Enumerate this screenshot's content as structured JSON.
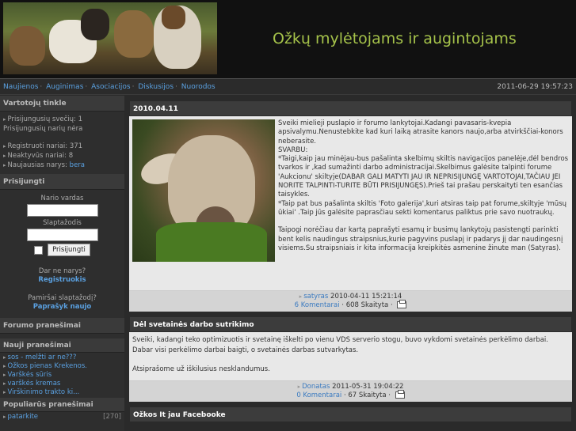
{
  "header": {
    "title": "Ožkų mylėtojams ir augintojams"
  },
  "nav": {
    "links": [
      "Naujienos",
      "Auginimas",
      "Asociacijos",
      "Diskusijos",
      "Nuorodos"
    ],
    "datetime": "2011-06-29 19:57:23"
  },
  "sidebar": {
    "users_panel": {
      "title": "Vartotojų tinkle",
      "online_guests": "Prisijungusių svečių: 1",
      "online_members": "Prisijungusių narių nėra",
      "registered": "Registruoti nariai: 371",
      "inactive": "Neaktyvūs nariai: 8",
      "newest_label": "Naujausias narys: ",
      "newest_name": "bera"
    },
    "login_panel": {
      "title": "Prisijungti",
      "username_label": "Nario vardas",
      "password_label": "Slaptažodis",
      "login_button": "Prisijungti",
      "not_member": "Dar ne narys?",
      "register_link": "Registruokis",
      "forgot": "Pamiršai slaptažodį?",
      "forgot_link": "Paprašyk naujo"
    },
    "forum_panel": {
      "title": "Forumo pranešimai"
    },
    "new_posts": {
      "title": "Nauji pranešimai",
      "items": [
        "sos - melžti ar ne???",
        "Ožkos pienas Krekenos.",
        "Varškės sūris",
        "varškės kremas",
        "Virškinimo trakto ki..."
      ]
    },
    "popular_posts": {
      "title": "Populiarūs pranešimai",
      "items": [
        {
          "label": "patarkite",
          "count": "[270]"
        }
      ]
    }
  },
  "posts": [
    {
      "title": "2010.04.11",
      "paragraphs": [
        "Sveiki mielieji puslapio ir forumo lankytojai.Kadangi pavasaris-kvepia apsivalymu.Nenustebkite kad kuri laiką atrasite kanors naujo,arba atvirkščiai-konors neberasite.",
        "SVARBU:",
        "*Taigi,kaip jau minėjau-bus pašalinta skelbimų skiltis navigacijos panelėje,dėl bendros tvarkos ir ,kad sumažinti darbo administracijai.Skelbimus galėsite talpinti forume 'Aukcionu' skiltyje(DABAR GALI MATYTI JAU IR NEPRISIJUNGĘ VARTOTOJAI,TAČIAU JEI NORITE TALPINTI-TURITE BŪTI PRISIJUNGĘS).Prieš tai prašau perskaityti ten esančias taisykles.",
        "*Taip pat bus pašalinta skiltis 'Foto galerija',kuri atsiras taip pat forume,skiltyje 'mūsų ūkiai' .Taip jūs galėsite paprasčiau sekti komentarus paliktus prie savo nuotraukų.",
        "Taipogi norėčiau dar kartą paprašyti esamų ir busimų lankytojų pasistengti parinkti bent kelis naudingus straipsnius,kurie pagyvins puslapį ir padarys jį dar naudingesnį visiems.Su straipsniais ir kita informacija kreipkitės asmenine žinute man (Satyras)."
      ],
      "author": "satyras",
      "date": "2010-04-11 15:21:14",
      "comments": "6 Komentarai",
      "reads": "608 Skaityta"
    },
    {
      "title": "Dėl svetainės darbo sutrikimo",
      "paragraphs": [
        "Sveiki, kadangi teko optimizuotis ir svetainę iškelti po vienu VDS serverio stogu, buvo vykdomi svetainės perkėlimo darbai. Dabar visi perkėlimo darbai baigti, o svetainės darbas sutvarkytas.",
        "Atsiprašome už iškilusius nesklandumus."
      ],
      "author": "Donatas",
      "date": "2011-05-31 19:04:22",
      "comments": "0 Komentarai",
      "reads": "67 Skaityta"
    },
    {
      "title": "Ožkos It jau Facebooke"
    }
  ]
}
